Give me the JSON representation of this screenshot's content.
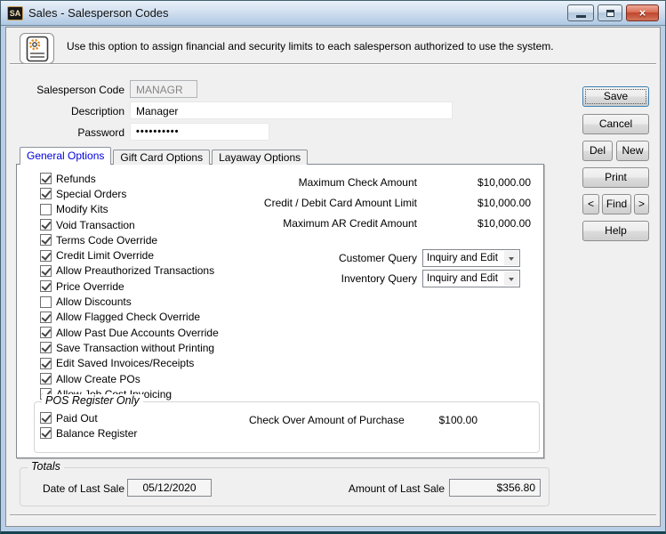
{
  "window": {
    "title": "Sales - Salesperson Codes",
    "app_icon": "SA"
  },
  "info": {
    "text": "Use this option to assign financial and security limits to each salesperson authorized  to use the system."
  },
  "form": {
    "code_label": "Salesperson Code",
    "code_value": "MANAGR",
    "description_label": "Description",
    "description_value": "Manager",
    "password_label": "Password",
    "password_value": "••••••••••"
  },
  "buttons": {
    "save": "Save",
    "cancel": "Cancel",
    "del": "Del",
    "new": "New",
    "print": "Print",
    "prev": "<",
    "find": "Find",
    "next": ">",
    "help": "Help"
  },
  "tabs": [
    {
      "label": "General Options",
      "active": true
    },
    {
      "label": "Gift Card Options",
      "active": false
    },
    {
      "label": "Layaway Options",
      "active": false
    }
  ],
  "general_options": {
    "checkboxes": [
      {
        "label": "Refunds",
        "checked": true
      },
      {
        "label": "Special Orders",
        "checked": true
      },
      {
        "label": "Modify Kits",
        "checked": false
      },
      {
        "label": "Void Transaction",
        "checked": true
      },
      {
        "label": "Terms Code Override",
        "checked": true
      },
      {
        "label": "Credit Limit Override",
        "checked": true
      },
      {
        "label": "Allow Preauthorized Transactions",
        "checked": true
      },
      {
        "label": "Price Override",
        "checked": true
      },
      {
        "label": "Allow Discounts",
        "checked": false
      },
      {
        "label": "Allow Flagged Check Override",
        "checked": true
      },
      {
        "label": "Allow Past Due Accounts Override",
        "checked": true
      },
      {
        "label": "Save Transaction without Printing",
        "checked": true
      },
      {
        "label": "Edit Saved Invoices/Receipts",
        "checked": true
      },
      {
        "label": "Allow Create POs",
        "checked": true
      },
      {
        "label": "Allow Job Cost Invoicing",
        "checked": true
      }
    ],
    "amounts": [
      {
        "label": "Maximum Check Amount",
        "value": "$10,000.00"
      },
      {
        "label": "Credit / Debit Card Amount Limit",
        "value": "$10,000.00"
      },
      {
        "label": "Maximum AR Credit Amount",
        "value": "$10,000.00"
      }
    ],
    "queries": [
      {
        "label": "Customer Query",
        "value": "Inquiry and Edit"
      },
      {
        "label": "Inventory Query",
        "value": "Inquiry and Edit"
      }
    ],
    "pos_register": {
      "title": "POS Register Only",
      "checkboxes": [
        {
          "label": "Paid Out",
          "checked": true
        },
        {
          "label": "Balance Register",
          "checked": true
        }
      ],
      "check_over_label": "Check Over Amount of Purchase",
      "check_over_value": "$100.00"
    }
  },
  "totals": {
    "title": "Totals",
    "date_label": "Date of Last Sale",
    "date_value": "05/12/2020",
    "amount_label": "Amount of Last Sale",
    "amount_value": "$356.80"
  },
  "colors": {
    "titlebar_top": "#e9f1fa",
    "titlebar_bottom": "#aec8e3",
    "frame": "#b9cfe8",
    "client_bg": "#f0f0f0",
    "active_tab_text": "#0000e0",
    "close_button": "#c4462e",
    "default_button_border": "#3c7fb1"
  }
}
